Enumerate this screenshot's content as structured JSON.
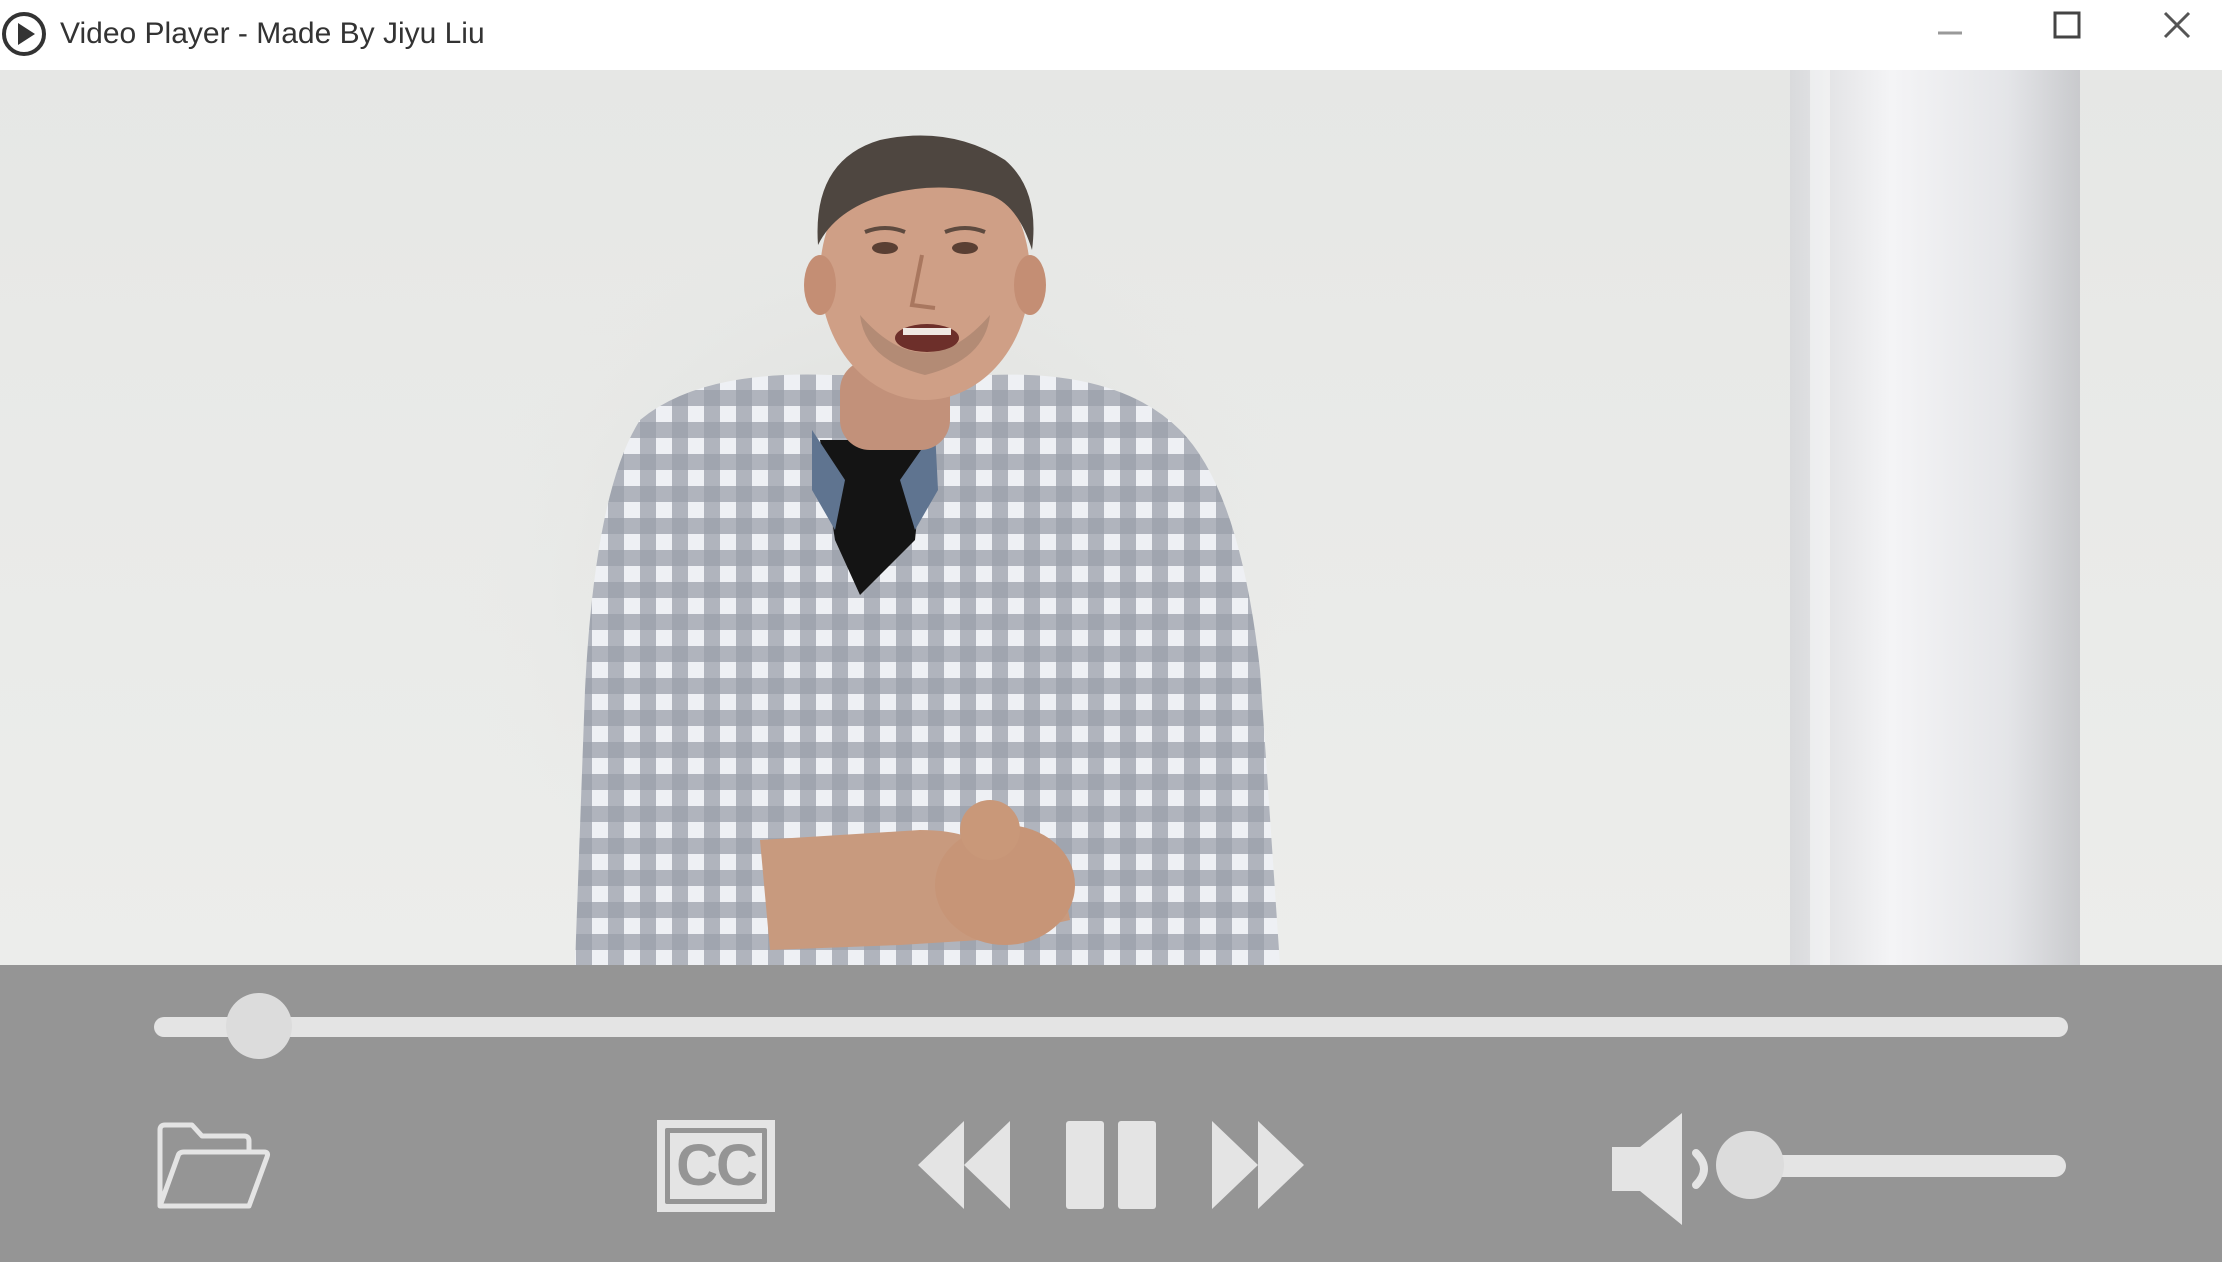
{
  "window": {
    "title": "Video Player - Made By Jiyu Liu",
    "app_icon": "play-circle-icon",
    "buttons": [
      "minimize-icon",
      "maximize-icon",
      "close-icon"
    ]
  },
  "video": {
    "content": "video-frame"
  },
  "controls": {
    "seek_progress": 0.055,
    "volume_level": 0.03,
    "open_button_icon": "folder-open-icon",
    "captions_label": "CC",
    "rewind_icon": "rewind-icon",
    "pause_icon": "pause-icon",
    "forward_icon": "fast-forward-icon",
    "volume_icon": "speaker-icon"
  },
  "colors": {
    "control_bar": "#959595",
    "control_glyph": "#e4e4e4",
    "title_text": "#333333"
  }
}
